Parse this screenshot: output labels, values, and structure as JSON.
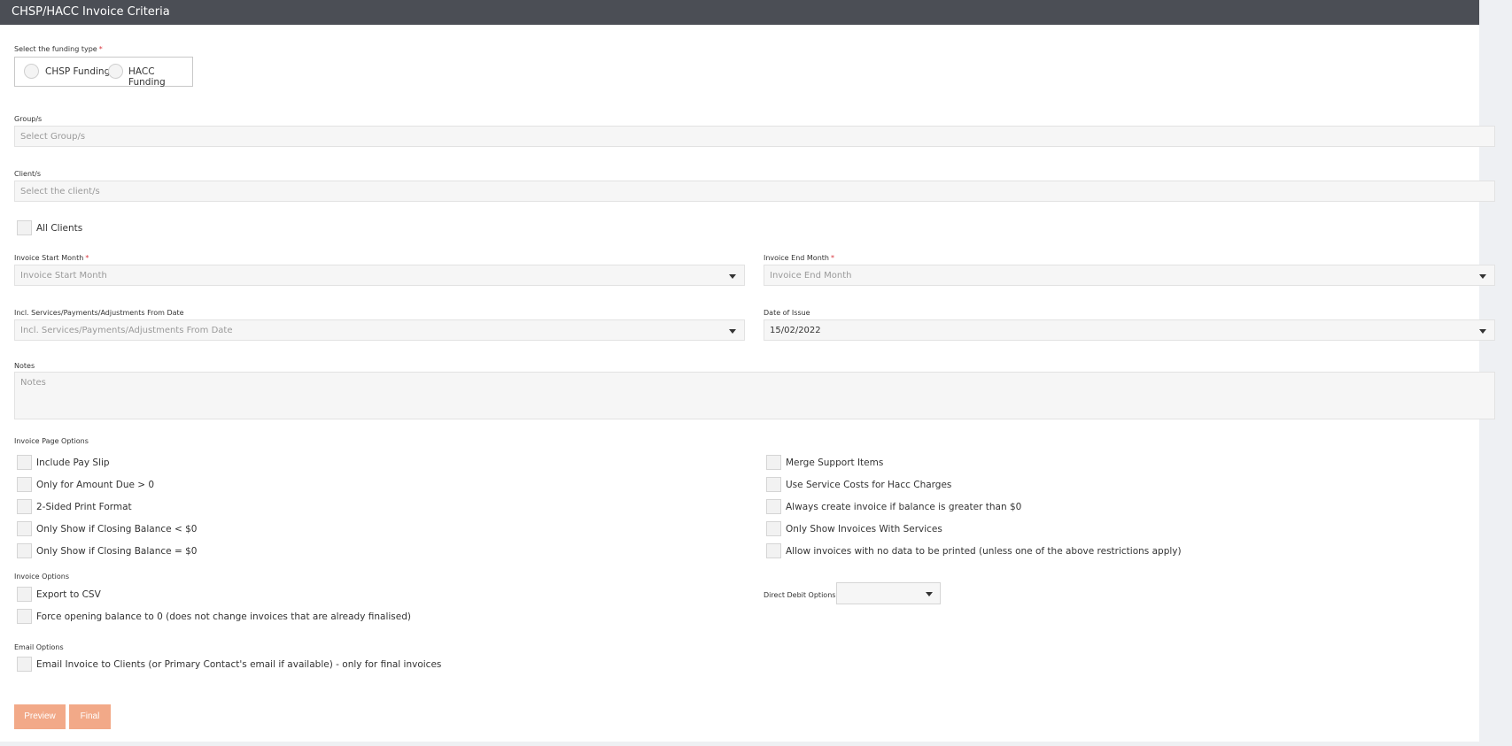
{
  "header": {
    "title": "CHSP/HACC Invoice Criteria"
  },
  "funding": {
    "label": "Select the funding type",
    "required": "*",
    "options": [
      "CHSP Funding",
      "HACC Funding"
    ]
  },
  "groups": {
    "label": "Group/s",
    "placeholder": "Select Group/s"
  },
  "clients": {
    "label": "Client/s",
    "placeholder": "Select the client/s",
    "all_clients": "All Clients"
  },
  "invoice_start": {
    "label": "Invoice Start Month",
    "required": "*",
    "placeholder": "Invoice Start Month"
  },
  "invoice_end": {
    "label": "Invoice End Month",
    "required": "*",
    "placeholder": "Invoice End Month"
  },
  "incl_from": {
    "label": "Incl. Services/Payments/Adjustments From Date",
    "placeholder": "Incl. Services/Payments/Adjustments From Date"
  },
  "date_of_issue": {
    "label": "Date of Issue",
    "value": "15/02/2022"
  },
  "notes": {
    "label": "Notes",
    "placeholder": "Notes"
  },
  "page_options": {
    "label": "Invoice Page Options",
    "left": [
      "Include Pay Slip",
      "Only for Amount Due > 0",
      "2-Sided Print Format",
      "Only Show if Closing Balance < $0",
      "Only Show if Closing Balance = $0"
    ],
    "right": [
      "Merge Support Items",
      "Use Service Costs for Hacc Charges",
      "Always create invoice if balance is greater than $0",
      "Only Show Invoices With Services",
      "Allow invoices with no data to be printed (unless one of the above restrictions apply)"
    ]
  },
  "invoice_options": {
    "label": "Invoice Options",
    "items": [
      "Export to CSV",
      "Force opening balance to 0 (does not change invoices that are already finalised)"
    ],
    "direct_debit_label": "Direct Debit Options:",
    "direct_debit_value": ""
  },
  "email_options": {
    "label": "Email Options",
    "items": [
      "Email Invoice to Clients (or Primary Contact's email if available) - only for final invoices"
    ]
  },
  "buttons": {
    "preview": "Preview",
    "final": "Final"
  },
  "colors": {
    "header_bg": "#4b4e55",
    "button_bg": "#f2a988",
    "required": "#d9363e"
  }
}
